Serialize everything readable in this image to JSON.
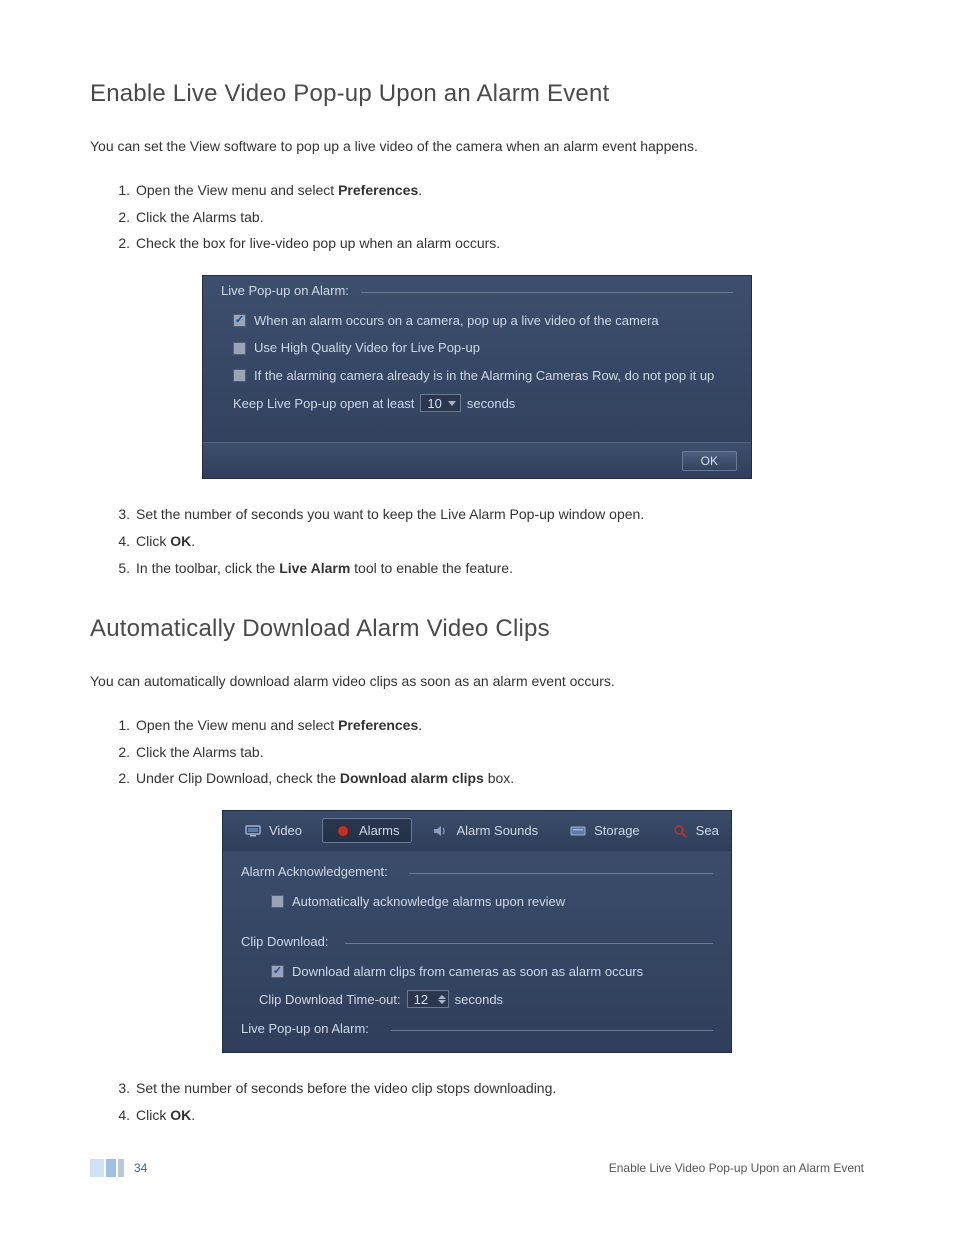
{
  "section1": {
    "title": "Enable Live Video Pop-up Upon an Alarm Event",
    "intro": "You can set the View software to pop up a live video of the camera when an alarm event happens.",
    "steps_a": [
      {
        "n": "1.",
        "pre": "Open the View menu and select ",
        "bold": "Preferences",
        "post": "."
      },
      {
        "n": "2.",
        "pre": "Click the Alarms tab.",
        "bold": "",
        "post": ""
      },
      {
        "n": "2.",
        "pre": "Check the box for live-video pop up when an alarm occurs.",
        "bold": "",
        "post": ""
      }
    ],
    "steps_b": [
      {
        "n": "3.",
        "pre": "Set the number of seconds you want to keep the Live Alarm Pop-up window open.",
        "bold": "",
        "post": ""
      },
      {
        "n": "4.",
        "pre": "Click ",
        "bold": "OK",
        "post": "."
      },
      {
        "n": "5.",
        "pre": "In the toolbar, click the ",
        "bold": "Live Alarm",
        "post": " tool to enable the feature."
      }
    ]
  },
  "popup_panel": {
    "legend": "Live Pop-up on Alarm:",
    "cb1": {
      "checked": true,
      "label": "When an alarm occurs on a camera, pop up a live video of the camera"
    },
    "cb2": {
      "checked": false,
      "label": "Use High Quality Video for Live Pop-up"
    },
    "cb3": {
      "checked": false,
      "label": "If the alarming camera already is in the Alarming Cameras Row, do not pop it up"
    },
    "keep": {
      "pre": "Keep Live Pop-up open at least",
      "value": "10",
      "post": "seconds"
    },
    "ok": "OK"
  },
  "section2": {
    "title": "Automatically Download Alarm Video Clips",
    "intro": "You can automatically download alarm video clips as soon as an alarm event occurs.",
    "steps_a": [
      {
        "n": "1.",
        "pre": "Open the View menu and select ",
        "bold": "Preferences",
        "post": "."
      },
      {
        "n": "2.",
        "pre": "Click the Alarms tab.",
        "bold": "",
        "post": ""
      },
      {
        "n": "2.",
        "pre": "Under Clip Download, check the ",
        "bold": "Download alarm clips",
        "post": " box."
      }
    ],
    "steps_b": [
      {
        "n": "3.",
        "pre": "Set the number of seconds before the video clip stops downloading.",
        "bold": "",
        "post": ""
      },
      {
        "n": "4.",
        "pre": "Click ",
        "bold": "OK",
        "post": "."
      }
    ]
  },
  "download_panel": {
    "tabs": {
      "video": "Video",
      "alarms": "Alarms",
      "alarm_sounds": "Alarm Sounds",
      "storage": "Storage",
      "search": "Sea"
    },
    "ack": {
      "legend": "Alarm Acknowledgement:",
      "cb": {
        "checked": false,
        "label": "Automatically acknowledge alarms upon review"
      }
    },
    "clip": {
      "legend": "Clip Download:",
      "cb": {
        "checked": true,
        "label": "Download alarm clips from cameras as soon as alarm occurs"
      },
      "timeout": {
        "pre": "Clip Download Time-out:",
        "value": "12",
        "post": "seconds"
      }
    },
    "live_legend": "Live Pop-up on Alarm:"
  },
  "footer": {
    "page": "34",
    "title": "Enable Live Video Pop-up Upon an Alarm Event"
  }
}
